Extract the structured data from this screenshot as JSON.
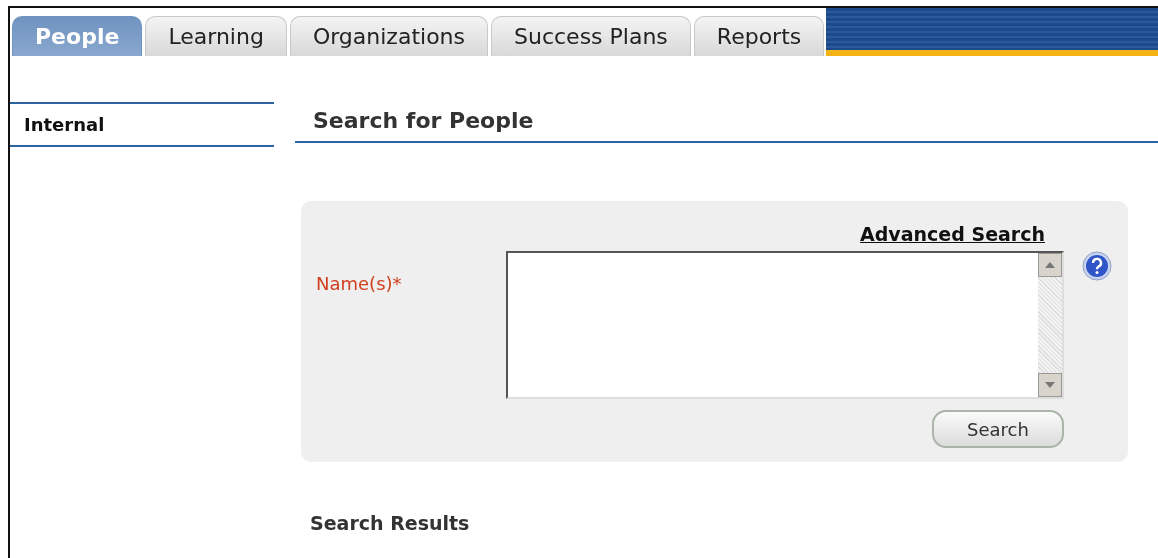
{
  "tabs": [
    {
      "label": "People",
      "selected": true
    },
    {
      "label": "Learning",
      "selected": false
    },
    {
      "label": "Organizations",
      "selected": false
    },
    {
      "label": "Success Plans",
      "selected": false
    },
    {
      "label": "Reports",
      "selected": false
    }
  ],
  "sidebar": {
    "items": [
      {
        "label": "Internal",
        "selected": false
      }
    ]
  },
  "main": {
    "heading": "Search for People",
    "search_panel": {
      "advanced_link": "Advanced Search",
      "field_label": "Name(s)*",
      "button": "Search"
    },
    "results_heading": "Search Results"
  }
}
